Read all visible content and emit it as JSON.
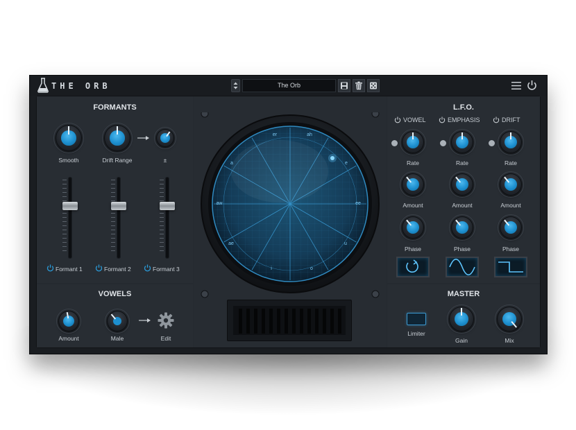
{
  "app": {
    "logo_text": "THE ORB"
  },
  "preset": {
    "name": "The Orb"
  },
  "formants": {
    "title": "FORMANTS",
    "knobs": [
      {
        "label": "Smooth",
        "value": 0.5
      },
      {
        "label": "Drift Range",
        "value": 0.5
      },
      {
        "label": "±",
        "value": 0.62
      }
    ],
    "faders": [
      {
        "label": "Formant 1",
        "value": 0.6
      },
      {
        "label": "Formant 2",
        "value": 0.6
      },
      {
        "label": "Formant 3",
        "value": 0.6
      }
    ]
  },
  "vowels": {
    "title": "VOWELS",
    "amount_label": "Amount",
    "mode_label": "Male",
    "edit_label": "Edit"
  },
  "orb": {
    "labels": [
      "er",
      "ah",
      "e",
      "ee",
      "u",
      "o",
      "i",
      "ae",
      "aw",
      "a"
    ]
  },
  "lfo": {
    "title": "L.F.O.",
    "columns": [
      {
        "name": "VOWEL",
        "rate": "Rate",
        "amount": "Amount",
        "phase": "Phase",
        "shape": "sample-hold-icon"
      },
      {
        "name": "EMPHASIS",
        "rate": "Rate",
        "amount": "Amount",
        "phase": "Phase",
        "shape": "sine-wave-icon"
      },
      {
        "name": "DRIFT",
        "rate": "Rate",
        "amount": "Amount",
        "phase": "Phase",
        "shape": "square-wave-icon"
      }
    ]
  },
  "master": {
    "title": "MASTER",
    "limiter_label": "Limiter",
    "gain_label": "Gain",
    "mix_label": "Mix"
  },
  "colors": {
    "accent": "#2a9ad8",
    "panel": "#282d33",
    "background": "#1a1d21"
  }
}
